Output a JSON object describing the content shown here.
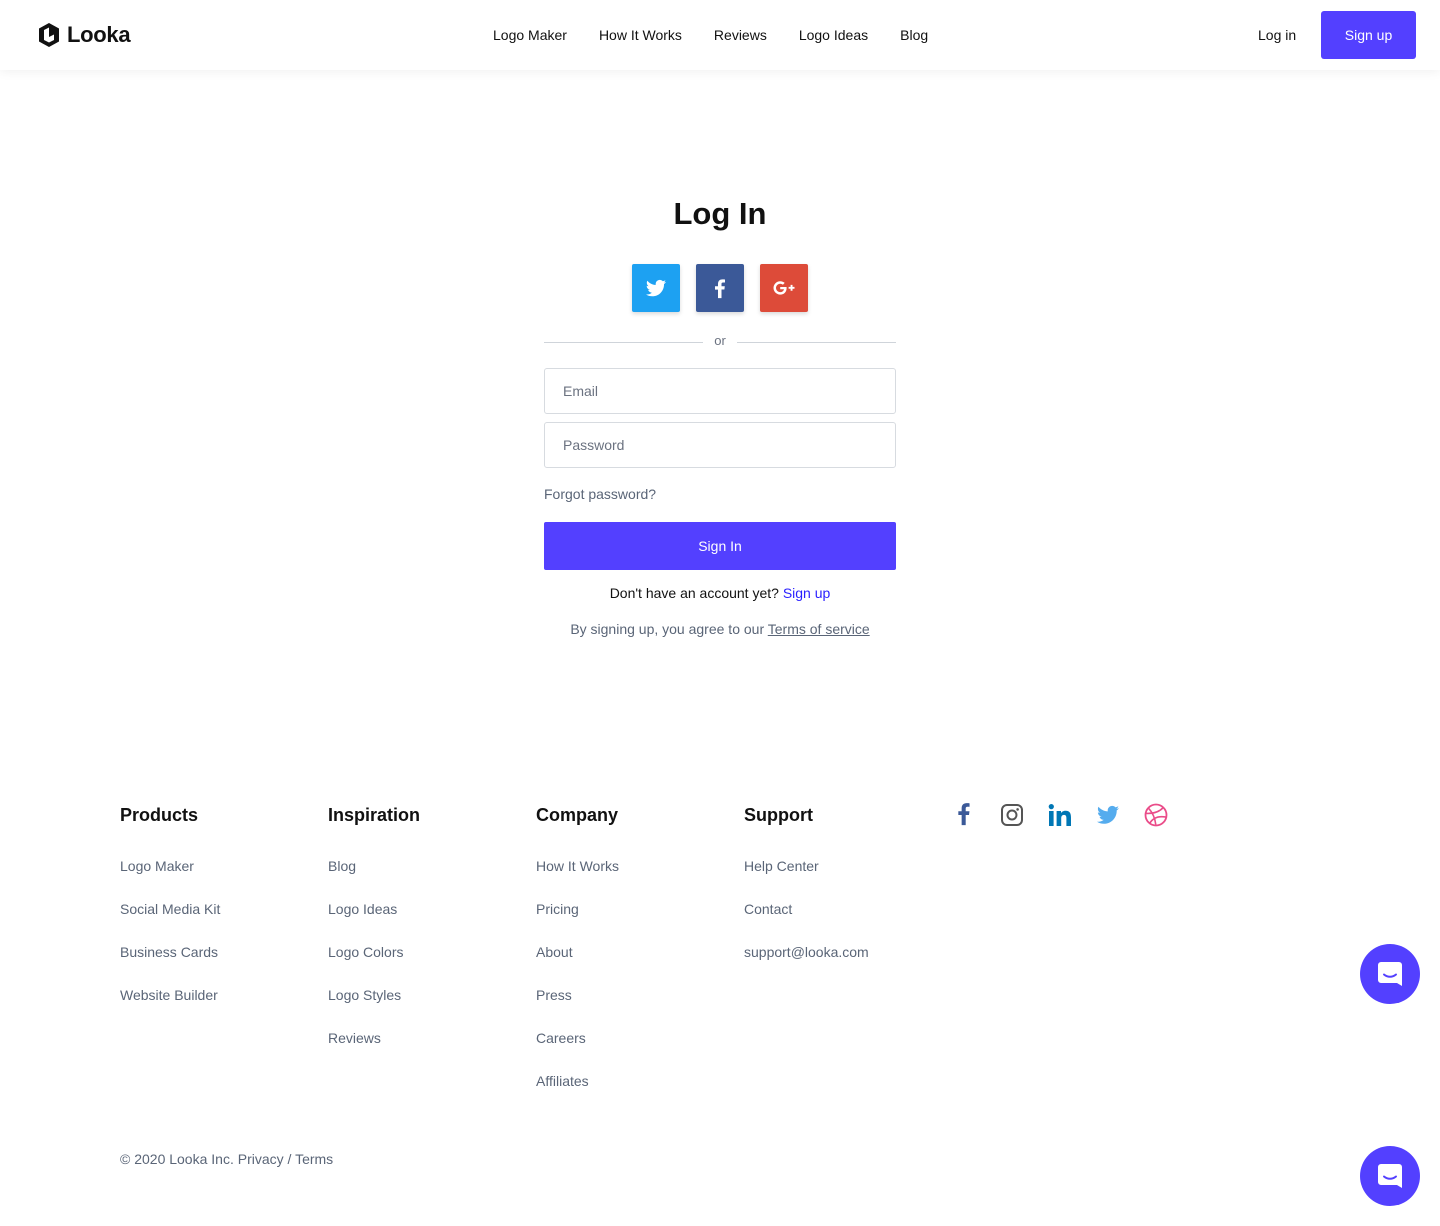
{
  "brand": {
    "name": "Looka",
    "accent": "#5340ff"
  },
  "header": {
    "nav": [
      "Logo Maker",
      "How It Works",
      "Reviews",
      "Logo Ideas",
      "Blog"
    ],
    "login_label": "Log in",
    "signup_label": "Sign up"
  },
  "login": {
    "title": "Log In",
    "social": [
      {
        "icon": "twitter-icon",
        "color": "#1da1f2"
      },
      {
        "icon": "facebook-icon",
        "color": "#3b5998"
      },
      {
        "icon": "google-plus-icon",
        "color": "#dd4b39"
      }
    ],
    "or_label": "or",
    "email_placeholder": "Email",
    "password_placeholder": "Password",
    "forgot_label": "Forgot password?",
    "signin_label": "Sign In",
    "no_account_text": "Don't have an account yet?",
    "signup_link": "Sign up",
    "terms_text": "By signing up, you agree to our",
    "terms_link": "Terms of service"
  },
  "footer": {
    "columns": [
      {
        "title": "Products",
        "links": [
          "Logo Maker",
          "Social Media Kit",
          "Business Cards",
          "Website Builder"
        ]
      },
      {
        "title": "Inspiration",
        "links": [
          "Blog",
          "Logo Ideas",
          "Logo Colors",
          "Logo Styles",
          "Reviews"
        ]
      },
      {
        "title": "Company",
        "links": [
          "How It Works",
          "Pricing",
          "About",
          "Press",
          "Careers",
          "Affiliates"
        ]
      },
      {
        "title": "Support",
        "links": [
          "Help Center",
          "Contact",
          "support@looka.com"
        ]
      }
    ],
    "social_icons": [
      "facebook-icon",
      "instagram-icon",
      "linkedin-icon",
      "twitter-icon",
      "dribbble-icon"
    ],
    "copyright": "© 2020 Looka Inc.",
    "privacy": "Privacy",
    "separator": "/",
    "terms": "Terms"
  },
  "chat": {
    "icon": "chat-icon"
  }
}
